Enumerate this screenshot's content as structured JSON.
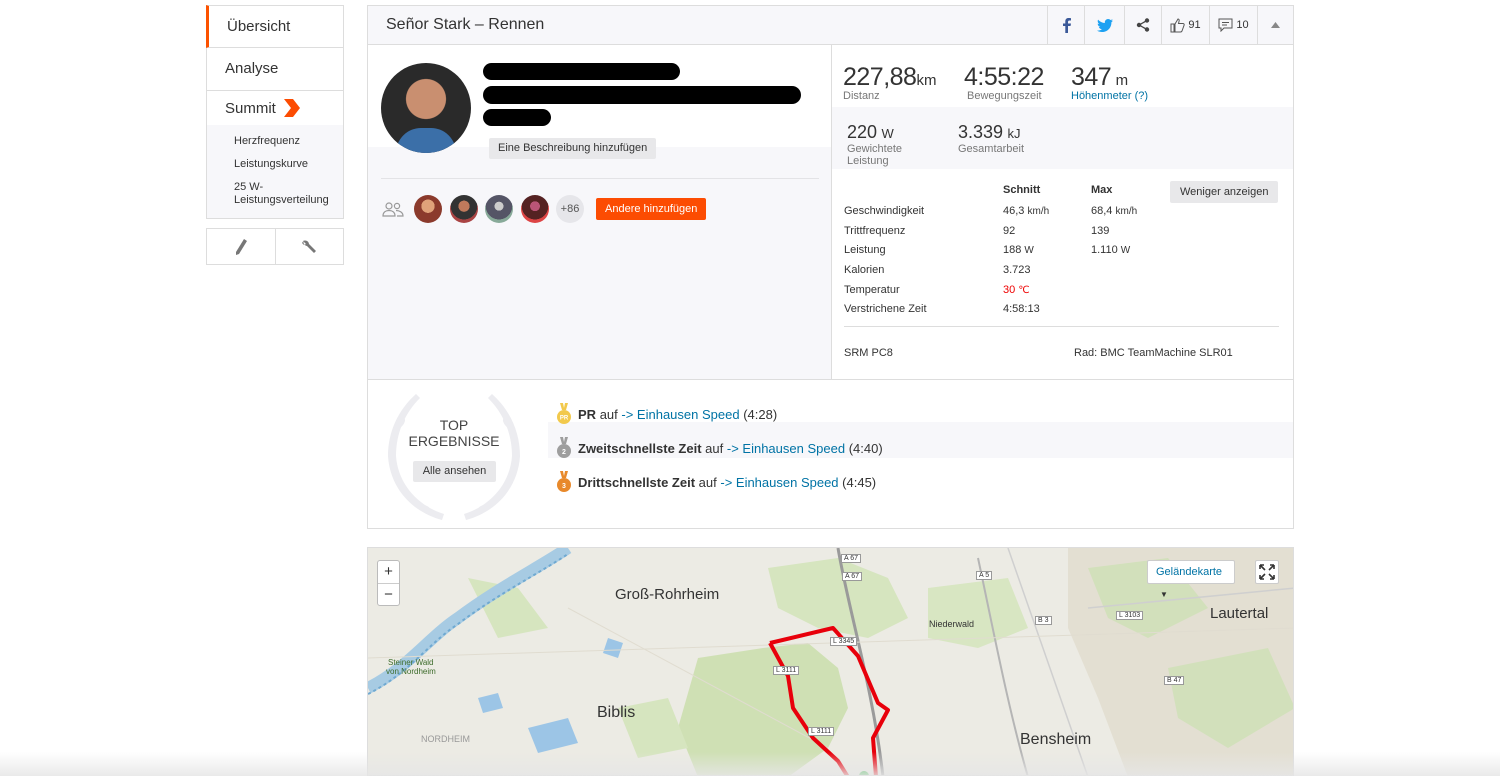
{
  "sidebar": {
    "items": [
      "Übersicht",
      "Analyse"
    ],
    "summit_label": "Summit",
    "summit_sub": [
      "Herzfrequenz",
      "Leistungskurve",
      "25 W-Leistungsverteilung"
    ]
  },
  "activity": {
    "title": "Señor Stark – Rennen",
    "kudos": "91",
    "comments": "10",
    "add_description": "Eine Beschreibung hinzufügen",
    "extra_athletes": "+86",
    "add_others": "Andere hinzufügen"
  },
  "stats": {
    "distance": {
      "value": "227,88",
      "unit": "km",
      "label": "Distanz"
    },
    "moving_time": {
      "value": "4:55:22",
      "label": "Bewegungszeit"
    },
    "elevation": {
      "value": "347",
      "unit": "m",
      "label": "Höhenmeter (?)"
    },
    "weighted_power": {
      "value": "220",
      "unit": "W",
      "label_1": "Gewichtete",
      "label_2": "Leistung"
    },
    "work": {
      "value": "3.339",
      "unit": "kJ",
      "label": "Gesamtarbeit"
    }
  },
  "table": {
    "col_avg": "Schnitt",
    "col_max": "Max",
    "toggle_label": "Weniger anzeigen",
    "rows": [
      {
        "label": "Geschwindigkeit",
        "avg": "46,3",
        "avg_unit": "km/h",
        "max": "68,4",
        "max_unit": "km/h"
      },
      {
        "label": "Trittfrequenz",
        "avg": "92",
        "avg_unit": "",
        "max": "139",
        "max_unit": ""
      },
      {
        "label": "Leistung",
        "avg": "188",
        "avg_unit": "W",
        "max": "1.110",
        "max_unit": "W"
      },
      {
        "label": "Kalorien",
        "avg": "3.723",
        "avg_unit": "",
        "max": "",
        "max_unit": ""
      },
      {
        "label": "Temperatur",
        "avg": "30",
        "avg_unit": "℃",
        "max": "",
        "max_unit": ""
      },
      {
        "label": "Verstrichene Zeit",
        "avg": "4:58:13",
        "avg_unit": "",
        "max": "",
        "max_unit": ""
      }
    ],
    "device": "SRM PC8",
    "bike": "Rad: BMC TeamMachine SLR01"
  },
  "top_results": {
    "title_1": "TOP",
    "title_2": "ERGEBNISSE",
    "button": "Alle ansehen",
    "items": [
      {
        "badge": "PR",
        "rank": "PR",
        "mid": "auf",
        "segment": "-> Einhausen Speed",
        "time": "(4:28)"
      },
      {
        "badge": "2",
        "rank": "Zweitschnellste Zeit",
        "mid": "auf",
        "segment": "-> Einhausen Speed",
        "time": "(4:40)"
      },
      {
        "badge": "3",
        "rank": "Drittschnellste Zeit",
        "mid": "auf",
        "segment": "-> Einhausen Speed",
        "time": "(4:45)"
      }
    ]
  },
  "map": {
    "zoom_in": "+",
    "zoom_out": "−",
    "type_label": "Geländekarte",
    "places": {
      "gross_rohrheim": "Groß-Rohrheim",
      "biblis": "Biblis",
      "bensheim": "Bensheim",
      "lautertal": "Lautertal",
      "niederwald": "Niederwald",
      "nordheim": "NORDHEIM",
      "steiner_wald_1": "Steiner Wald",
      "steiner_wald_2": "von Nordheim"
    },
    "roads": {
      "a67a": "A 67",
      "a67b": "A 67",
      "a5": "A 5",
      "b3": "B 3",
      "l3103": "L 3103",
      "b47": "B 47",
      "l3111a": "L 3111",
      "l3111b": "L 3111",
      "l3345": "L 3345"
    }
  },
  "colors": {
    "accent": "#fc4c02",
    "link": "#0073a5",
    "route": "#e8000b"
  }
}
